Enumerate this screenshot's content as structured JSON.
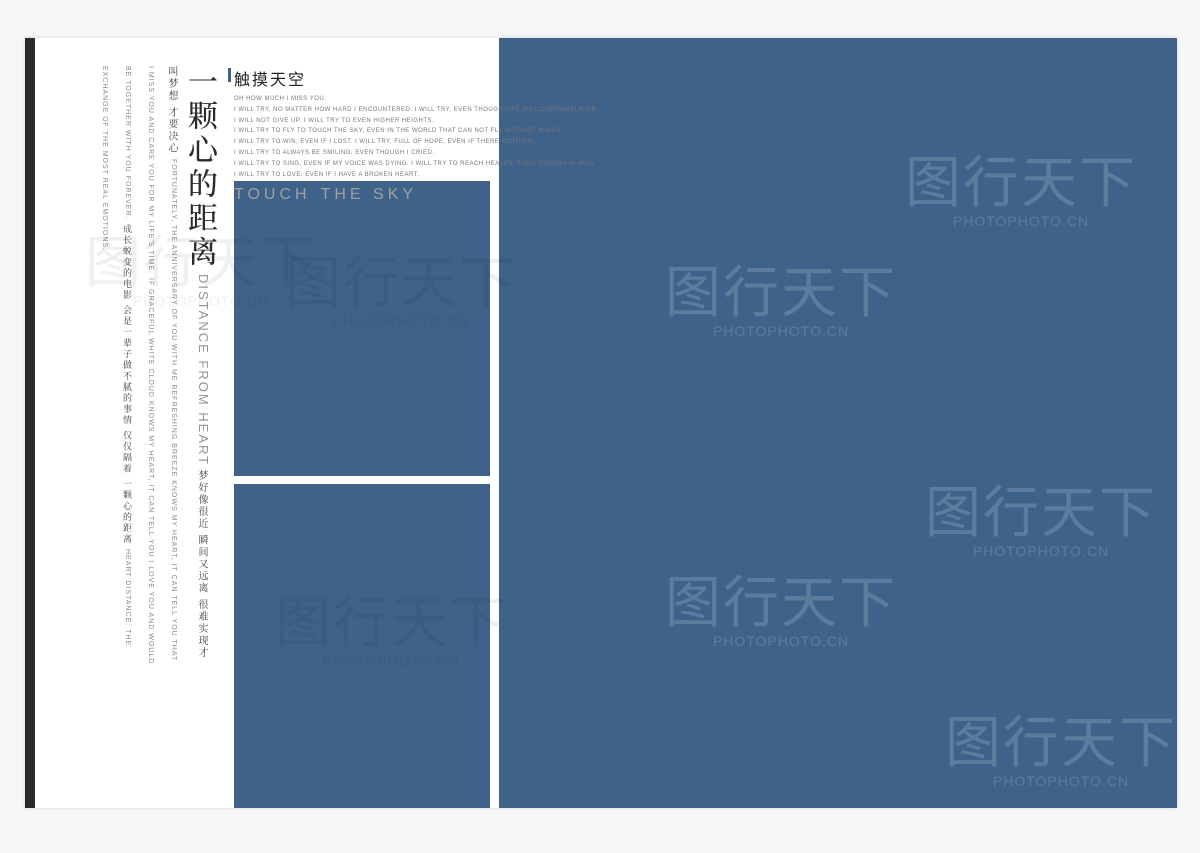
{
  "vertical": {
    "title_cn": "一颗心的距离",
    "title_en": "DISTANCE FROM HEART",
    "sub_cn": "梦好像很近 瞬间又远离 很难实现才叫梦想 才要决心",
    "sub_en_1": "FORTUNATELY, THE ANNIVERSARY OF YOU WITH ME REFRESHING BREEZE KNOWS MY HEART, IT CAN TELL YOU THAT I MISS YOU AND CARE YOU FOR MY LIFE'S TIME.",
    "sub_en_2": "IF GRACEFUL WHITE CLOUD KNOWS MY HEART, IT CAN TELL YOU I LOVE YOU AND WOULD BE TOGETHER WITH YOU FOREVER.",
    "foot_cn": "成长蜕变的电影 会是一辈子做不腻的事情 仅仅隔着 一颗心的距离",
    "foot_en": "HEART DISTANCE: THE EXCHANGE OF THE MOST REAL EMOTIONS."
  },
  "touch": {
    "cn": "触摸天空",
    "lines": [
      "OH HOW MUCH I MISS YOU.",
      "I WILL TRY, NO MATTER HOW HARD I ENCOUNTERED. I WILL TRY, EVEN THOUGH LIFE WILL OVERWHELM ME.",
      "I WILL NOT GIVE UP. I WILL TRY TO EVEN HIGHER HEIGHTS.",
      "I WILL TRY TO FLY TO TOUCH THE SKY, EVEN IN THE WORLD THAT CAN NOT FLY WITHOUT WINGS.",
      "I WILL TRY TO WIN, EVEN IF I LOST. I WILL TRY, FULL OF HOPE, EVEN IF THERE NOTHING.",
      "I WILL TRY TO ALWAYS BE SMILING, EVEN THOUGH I CRIED.",
      "I WILL TRY TO SING, EVEN IF MY VOICE WAS DYING. I WILL TRY TO REACH HEAVEN, EVEN THOUGH IN HELL.",
      "I WILL TRY TO LOVE, EVEN IF I HAVE A BROKEN HEART."
    ],
    "en_big_1": "TOUCH",
    "en_big_2": "THE SKY"
  },
  "watermark": {
    "main": "图行天下",
    "sub": "PHOTOPHOTO.CN"
  }
}
